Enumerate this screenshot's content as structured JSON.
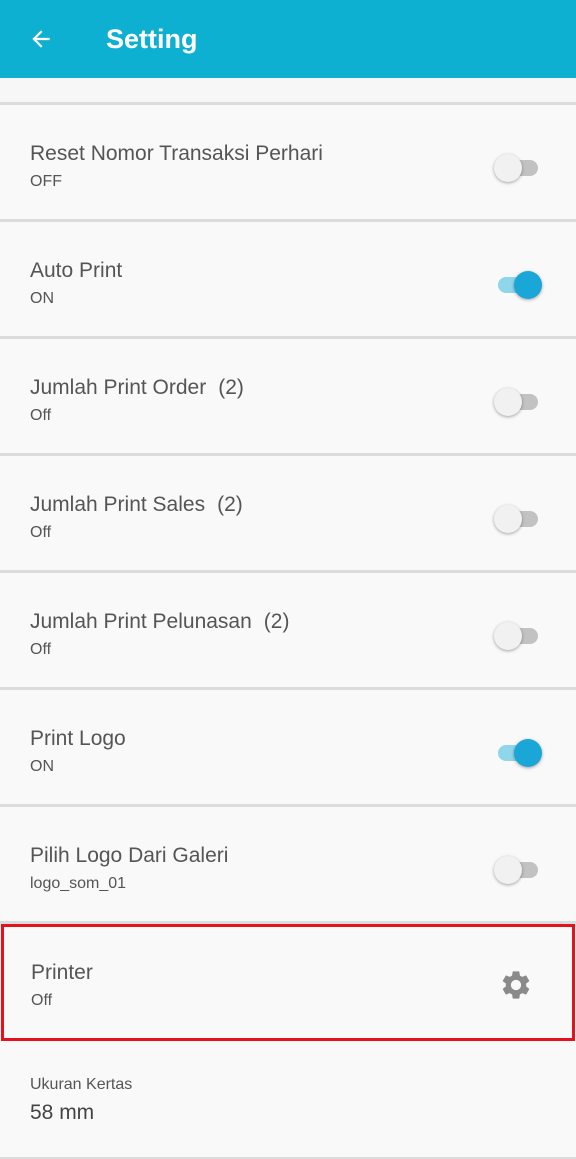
{
  "header": {
    "title": "Setting",
    "background": "#0eb0d2"
  },
  "settings": [
    {
      "label": "Reset Nomor Transaksi Perhari",
      "count": "",
      "sub": "OFF",
      "toggle": "off"
    },
    {
      "label": "Auto Print",
      "count": "",
      "sub": "ON",
      "toggle": "on"
    },
    {
      "label": "Jumlah Print Order",
      "count": "(2)",
      "sub": "Off",
      "toggle": "off"
    },
    {
      "label": "Jumlah Print Sales",
      "count": "(2)",
      "sub": "Off",
      "toggle": "off"
    },
    {
      "label": "Jumlah Print Pelunasan",
      "count": "(2)",
      "sub": "Off",
      "toggle": "off"
    },
    {
      "label": "Print Logo",
      "count": "",
      "sub": "ON",
      "toggle": "on"
    },
    {
      "label": "Pilih Logo Dari Galeri",
      "count": "",
      "sub": "logo_som_01",
      "toggle": "off"
    }
  ],
  "printer": {
    "label": "Printer",
    "sub": "Off",
    "icon": "gear-icon",
    "highlight_color": "#e3121b"
  },
  "paper": {
    "label": "Ukuran Kertas",
    "value": "58 mm"
  },
  "colors": {
    "toggle_on": "#1ba6d8",
    "toggle_off": "#c2c2c2"
  }
}
